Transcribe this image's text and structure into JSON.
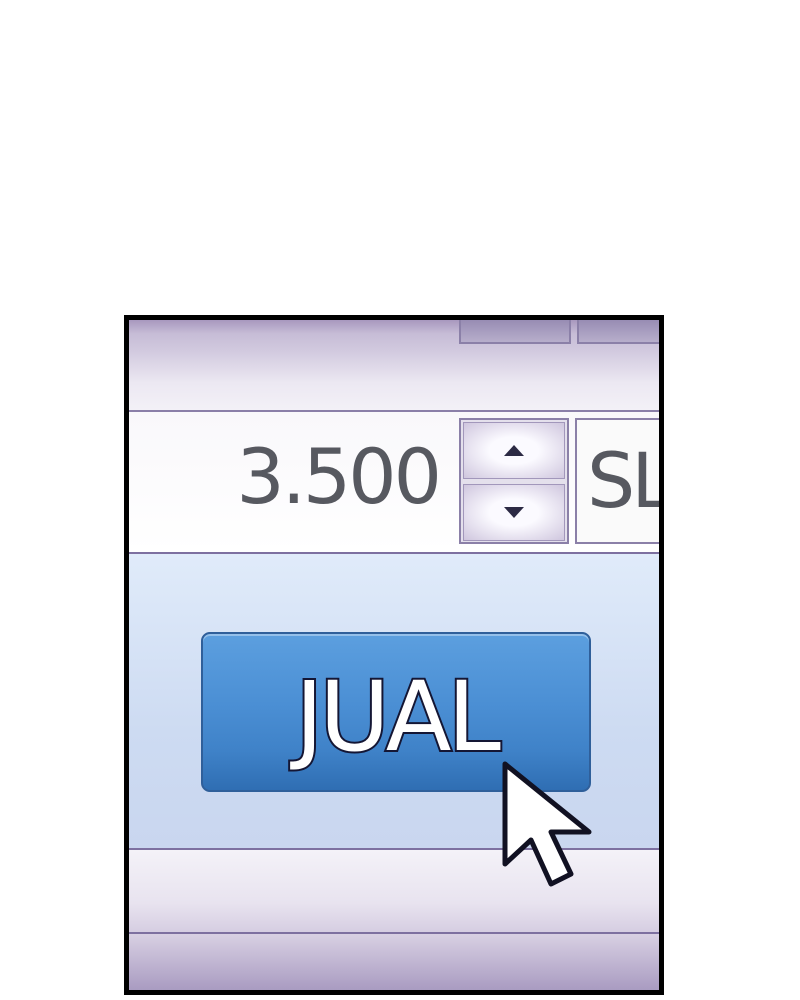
{
  "order_panel": {
    "quantity": {
      "value": "3.500",
      "increment_icon": "triangle-up-icon",
      "decrement_icon": "triangle-down-icon"
    },
    "side_selector": {
      "label": "SL"
    },
    "action_button": {
      "label": "JUAL"
    },
    "pointer": {
      "icon": "mouse-pointer-icon"
    }
  },
  "colors": {
    "button_blue": "#4b8fd4",
    "border_purple": "#8b80a8",
    "text_gray": "#575960"
  }
}
